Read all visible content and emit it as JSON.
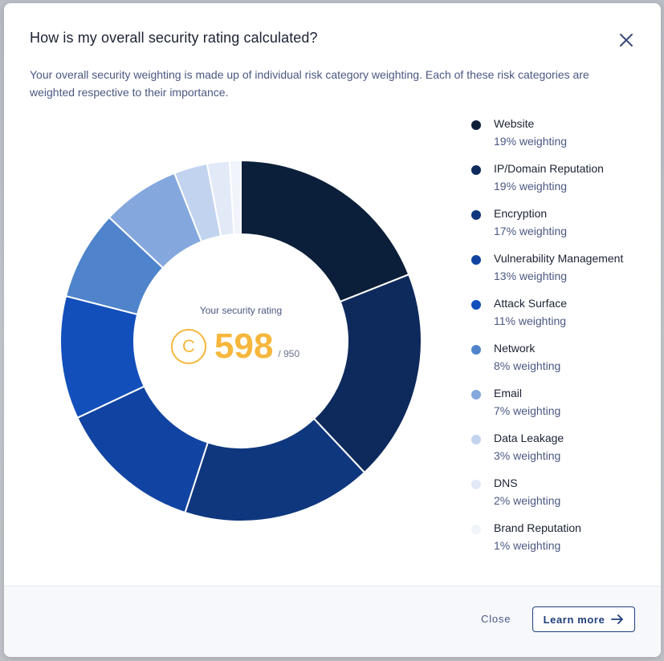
{
  "modal": {
    "title": "How is my overall security rating calculated?",
    "description": "Your overall security weighting is made up of individual risk category weighting. Each of these risk categories are weighted respective to their importance.",
    "close_icon": "close-icon"
  },
  "rating": {
    "label": "Your security rating",
    "grade_letter": "C",
    "score": "598",
    "max": "/ 950",
    "color": "#f6b73c"
  },
  "chart_data": {
    "type": "pie",
    "donut": true,
    "categories": [
      "Website",
      "IP/Domain Reputation",
      "Encryption",
      "Vulnerability Management",
      "Attack Surface",
      "Network",
      "Email",
      "Data Leakage",
      "DNS",
      "Brand Reputation"
    ],
    "values": [
      19,
      19,
      17,
      13,
      11,
      8,
      7,
      3,
      2,
      1
    ],
    "unit": "% weighting",
    "colors": [
      "#0b1f3a",
      "#0e2a5c",
      "#0f377e",
      "#1144a2",
      "#124fbb",
      "#4f84cc",
      "#84a8dd",
      "#c1d3ee",
      "#e2eaf7",
      "#f1f4fa"
    ],
    "legend_position": "right"
  },
  "legend": {
    "items": [
      {
        "name": "Website",
        "weighting": "19% weighting",
        "color": "#0b1f3a"
      },
      {
        "name": "IP/Domain Reputation",
        "weighting": "19% weighting",
        "color": "#0e2a5c"
      },
      {
        "name": "Encryption",
        "weighting": "17% weighting",
        "color": "#0f377e"
      },
      {
        "name": "Vulnerability Management",
        "weighting": "13% weighting",
        "color": "#1144a2"
      },
      {
        "name": "Attack Surface",
        "weighting": "11% weighting",
        "color": "#124fbb"
      },
      {
        "name": "Network",
        "weighting": "8% weighting",
        "color": "#4f84cc"
      },
      {
        "name": "Email",
        "weighting": "7% weighting",
        "color": "#84a8dd"
      },
      {
        "name": "Data Leakage",
        "weighting": "3% weighting",
        "color": "#c1d3ee"
      },
      {
        "name": "DNS",
        "weighting": "2% weighting",
        "color": "#e2eaf7"
      },
      {
        "name": "Brand Reputation",
        "weighting": "1% weighting",
        "color": "#f1f4fa"
      }
    ]
  },
  "footer": {
    "close_label": "Close",
    "learn_more_label": "Learn more",
    "arrow_icon": "arrow-right-icon"
  }
}
